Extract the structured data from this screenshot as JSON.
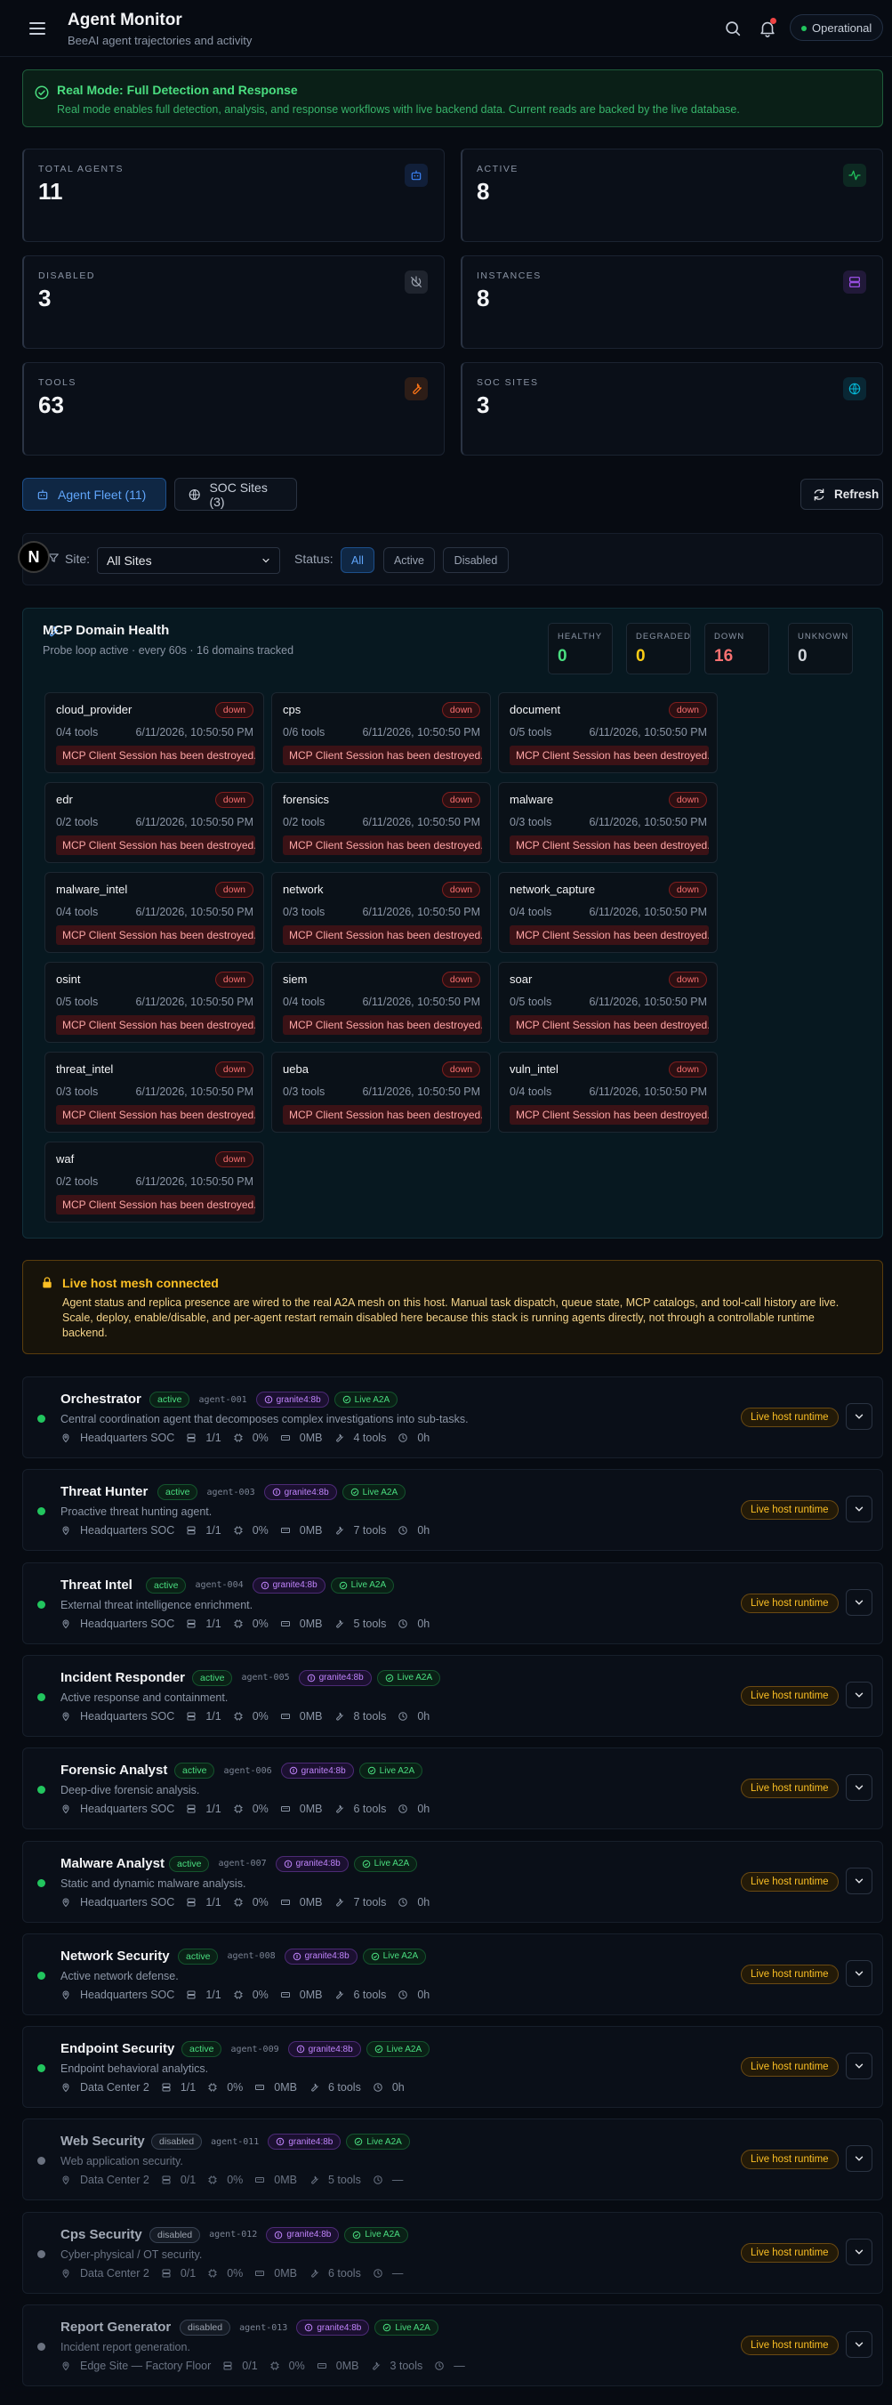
{
  "header": {
    "title": "Agent Monitor",
    "subtitle": "BeeAI agent trajectories and activity",
    "status": "Operational"
  },
  "banner": {
    "title": "Real Mode: Full Detection and Response",
    "text": "Real mode enables full detection, analysis, and response workflows with live backend data. Current reads are backed by the live database."
  },
  "stats": [
    {
      "label": "TOTAL AGENTS",
      "value": "11",
      "icon": "robot-icon",
      "color": "#3b82f6"
    },
    {
      "label": "ACTIVE",
      "value": "8",
      "icon": "activity-icon",
      "color": "#22c55e"
    },
    {
      "label": "DISABLED",
      "value": "3",
      "icon": "power-off-icon",
      "color": "#9ca3af"
    },
    {
      "label": "INSTANCES",
      "value": "8",
      "icon": "server-icon",
      "color": "#a855f7"
    },
    {
      "label": "TOOLS",
      "value": "63",
      "icon": "wrench-icon",
      "color": "#f97316"
    },
    {
      "label": "SOC SITES",
      "value": "3",
      "icon": "globe-icon",
      "color": "#06b6d4"
    }
  ],
  "tabs": {
    "fleet": "Agent Fleet (11)",
    "soc": "SOC Sites (3)",
    "refresh": "Refresh"
  },
  "filters": {
    "site_label": "Site:",
    "site_value": "All Sites",
    "status_label": "Status:",
    "chips": [
      "All",
      "Active",
      "Disabled"
    ]
  },
  "mcp": {
    "title": "MCP Domain Health",
    "subtitle": "Probe loop active · every 60s · 16 domains tracked",
    "health": [
      {
        "label": "HEALTHY",
        "value": "0",
        "color": "#4ade80"
      },
      {
        "label": "DEGRADED",
        "value": "0",
        "color": "#facc15"
      },
      {
        "label": "DOWN",
        "value": "16",
        "color": "#f87171"
      },
      {
        "label": "UNKNOWN",
        "value": "0",
        "color": "#d1d5db"
      }
    ],
    "domains": [
      {
        "name": "cloud_provider",
        "status": "down",
        "tools": "0/4 tools",
        "time": "6/11/2026, 10:50:50 PM",
        "error": "MCP Client Session has been destroyed."
      },
      {
        "name": "cps",
        "status": "down",
        "tools": "0/6 tools",
        "time": "6/11/2026, 10:50:50 PM",
        "error": "MCP Client Session has been destroyed."
      },
      {
        "name": "document",
        "status": "down",
        "tools": "0/5 tools",
        "time": "6/11/2026, 10:50:50 PM",
        "error": "MCP Client Session has been destroyed."
      },
      {
        "name": "edr",
        "status": "down",
        "tools": "0/2 tools",
        "time": "6/11/2026, 10:50:50 PM",
        "error": "MCP Client Session has been destroyed."
      },
      {
        "name": "forensics",
        "status": "down",
        "tools": "0/2 tools",
        "time": "6/11/2026, 10:50:50 PM",
        "error": "MCP Client Session has been destroyed."
      },
      {
        "name": "malware",
        "status": "down",
        "tools": "0/3 tools",
        "time": "6/11/2026, 10:50:50 PM",
        "error": "MCP Client Session has been destroyed."
      },
      {
        "name": "malware_intel",
        "status": "down",
        "tools": "0/4 tools",
        "time": "6/11/2026, 10:50:50 PM",
        "error": "MCP Client Session has been destroyed."
      },
      {
        "name": "network",
        "status": "down",
        "tools": "0/3 tools",
        "time": "6/11/2026, 10:50:50 PM",
        "error": "MCP Client Session has been destroyed."
      },
      {
        "name": "network_capture",
        "status": "down",
        "tools": "0/4 tools",
        "time": "6/11/2026, 10:50:50 PM",
        "error": "MCP Client Session has been destroyed."
      },
      {
        "name": "osint",
        "status": "down",
        "tools": "0/5 tools",
        "time": "6/11/2026, 10:50:50 PM",
        "error": "MCP Client Session has been destroyed."
      },
      {
        "name": "siem",
        "status": "down",
        "tools": "0/4 tools",
        "time": "6/11/2026, 10:50:50 PM",
        "error": "MCP Client Session has been destroyed."
      },
      {
        "name": "soar",
        "status": "down",
        "tools": "0/5 tools",
        "time": "6/11/2026, 10:50:50 PM",
        "error": "MCP Client Session has been destroyed."
      },
      {
        "name": "threat_intel",
        "status": "down",
        "tools": "0/3 tools",
        "time": "6/11/2026, 10:50:50 PM",
        "error": "MCP Client Session has been destroyed."
      },
      {
        "name": "ueba",
        "status": "down",
        "tools": "0/3 tools",
        "time": "6/11/2026, 10:50:50 PM",
        "error": "MCP Client Session has been destroyed."
      },
      {
        "name": "vuln_intel",
        "status": "down",
        "tools": "0/4 tools",
        "time": "6/11/2026, 10:50:50 PM",
        "error": "MCP Client Session has been destroyed."
      },
      {
        "name": "waf",
        "status": "down",
        "tools": "0/2 tools",
        "time": "6/11/2026, 10:50:50 PM",
        "error": "MCP Client Session has been destroyed."
      }
    ]
  },
  "mesh": {
    "title": "Live host mesh connected",
    "text": "Agent status and replica presence are wired to the real A2A mesh on this host. Manual task dispatch, queue state, MCP catalogs, and tool-call history are live. Scale, deploy, enable/disable, and per-agent restart remain disabled here because this stack is running agents directly, not through a controllable runtime backend."
  },
  "agents": [
    {
      "name": "Orchestrator",
      "status": "active",
      "id": "agent-001",
      "model": "granite4:8b",
      "a2a": "Live A2A",
      "desc": "Central coordination agent that decomposes complex investigations into sub-tasks.",
      "site": "Headquarters SOC",
      "replicas": "1/1",
      "cpu": "0%",
      "mem": "0MB",
      "tools": "4 tools",
      "uptime": "0h",
      "runtime": "Live host runtime"
    },
    {
      "name": "Threat Hunter",
      "status": "active",
      "id": "agent-003",
      "model": "granite4:8b",
      "a2a": "Live A2A",
      "desc": "Proactive threat hunting agent.",
      "site": "Headquarters SOC",
      "replicas": "1/1",
      "cpu": "0%",
      "mem": "0MB",
      "tools": "7 tools",
      "uptime": "0h",
      "runtime": "Live host runtime"
    },
    {
      "name": "Threat Intel",
      "status": "active",
      "id": "agent-004",
      "model": "granite4:8b",
      "a2a": "Live A2A",
      "desc": "External threat intelligence enrichment.",
      "site": "Headquarters SOC",
      "replicas": "1/1",
      "cpu": "0%",
      "mem": "0MB",
      "tools": "5 tools",
      "uptime": "0h",
      "runtime": "Live host runtime"
    },
    {
      "name": "Incident Responder",
      "status": "active",
      "id": "agent-005",
      "model": "granite4:8b",
      "a2a": "Live A2A",
      "desc": "Active response and containment.",
      "site": "Headquarters SOC",
      "replicas": "1/1",
      "cpu": "0%",
      "mem": "0MB",
      "tools": "8 tools",
      "uptime": "0h",
      "runtime": "Live host runtime"
    },
    {
      "name": "Forensic Analyst",
      "status": "active",
      "id": "agent-006",
      "model": "granite4:8b",
      "a2a": "Live A2A",
      "desc": "Deep-dive forensic analysis.",
      "site": "Headquarters SOC",
      "replicas": "1/1",
      "cpu": "0%",
      "mem": "0MB",
      "tools": "6 tools",
      "uptime": "0h",
      "runtime": "Live host runtime"
    },
    {
      "name": "Malware Analyst",
      "status": "active",
      "id": "agent-007",
      "model": "granite4:8b",
      "a2a": "Live A2A",
      "desc": "Static and dynamic malware analysis.",
      "site": "Headquarters SOC",
      "replicas": "1/1",
      "cpu": "0%",
      "mem": "0MB",
      "tools": "7 tools",
      "uptime": "0h",
      "runtime": "Live host runtime"
    },
    {
      "name": "Network Security",
      "status": "active",
      "id": "agent-008",
      "model": "granite4:8b",
      "a2a": "Live A2A",
      "desc": "Active network defense.",
      "site": "Headquarters SOC",
      "replicas": "1/1",
      "cpu": "0%",
      "mem": "0MB",
      "tools": "6 tools",
      "uptime": "0h",
      "runtime": "Live host runtime"
    },
    {
      "name": "Endpoint Security",
      "status": "active",
      "id": "agent-009",
      "model": "granite4:8b",
      "a2a": "Live A2A",
      "desc": "Endpoint behavioral analytics.",
      "site": "Data Center 2",
      "replicas": "1/1",
      "cpu": "0%",
      "mem": "0MB",
      "tools": "6 tools",
      "uptime": "0h",
      "runtime": "Live host runtime"
    },
    {
      "name": "Web Security",
      "status": "disabled",
      "id": "agent-011",
      "model": "granite4:8b",
      "a2a": "Live A2A",
      "desc": "Web application security.",
      "site": "Data Center 2",
      "replicas": "0/1",
      "cpu": "0%",
      "mem": "0MB",
      "tools": "5 tools",
      "uptime": "—",
      "runtime": "Live host runtime"
    },
    {
      "name": "Cps Security",
      "status": "disabled",
      "id": "agent-012",
      "model": "granite4:8b",
      "a2a": "Live A2A",
      "desc": "Cyber-physical / OT security.",
      "site": "Data Center 2",
      "replicas": "0/1",
      "cpu": "0%",
      "mem": "0MB",
      "tools": "6 tools",
      "uptime": "—",
      "runtime": "Live host runtime"
    },
    {
      "name": "Report Generator",
      "status": "disabled",
      "id": "agent-013",
      "model": "granite4:8b",
      "a2a": "Live A2A",
      "desc": "Incident report generation.",
      "site": "Edge Site — Factory Floor",
      "replicas": "0/1",
      "cpu": "0%",
      "mem": "0MB",
      "tools": "3 tools",
      "uptime": "—",
      "runtime": "Live host runtime"
    }
  ]
}
